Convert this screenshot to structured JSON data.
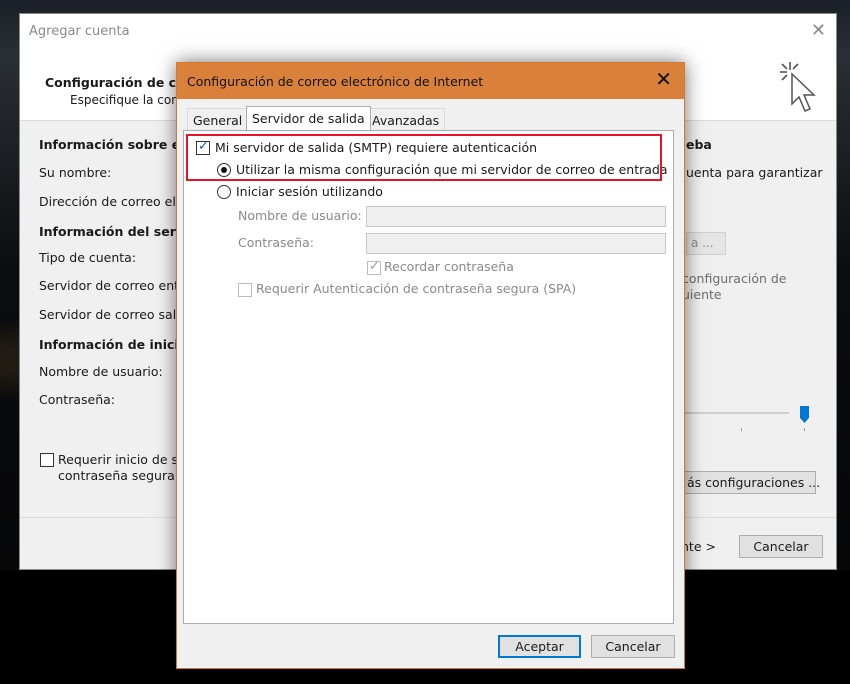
{
  "background_window": {
    "title": "Agregar cuenta",
    "close_glyph": "✕",
    "header_title": "Configuración de cue",
    "header_subtitle": "Especifique la confi",
    "left": {
      "section_user": "Información sobre el u",
      "your_name": "Su nombre:",
      "email": "Dirección de correo ele",
      "section_server": "Información del servido",
      "account_type": "Tipo de cuenta:",
      "incoming_server": "Servidor de correo entr",
      "outgoing_server": "Servidor de correo salie",
      "section_login": "Información de inicio d",
      "username": "Nombre de usuario:",
      "password": "Contraseña:",
      "require_login_line1": "Requerir inicio de se",
      "require_login_line2": "contraseña segura ("
    },
    "right": {
      "test_heading": "eba",
      "test_text": "uenta para garantizar",
      "test_button": "a ...",
      "config_text_line1": "configuración de",
      "config_text_line2": "uiente",
      "more_settings_button": "ás configuraciones ...",
      "next_button": "nte >",
      "cancel_button": "Cancelar"
    }
  },
  "dialog": {
    "title": "Configuración de correo electrónico de Internet",
    "close_glyph": "✕",
    "tabs": [
      {
        "label": "General",
        "active": false
      },
      {
        "label": "Servidor de salida",
        "active": true
      },
      {
        "label": "Avanzadas",
        "active": false
      }
    ],
    "smtp_auth": {
      "label": "Mi servidor de salida (SMTP) requiere autenticación",
      "checked": true
    },
    "use_same": {
      "label": "Utilizar la misma configuración que mi servidor de correo de entrada",
      "selected": true
    },
    "login_using": {
      "label": "Iniciar sesión utilizando",
      "selected": false
    },
    "username_label": "Nombre de usuario:",
    "username_value": "",
    "password_label": "Contraseña:",
    "password_value": "",
    "remember_password": {
      "label": "Recordar contraseña",
      "checked": true
    },
    "spa": {
      "label": "Requerir Autenticación de contraseña segura (SPA)",
      "checked": false
    },
    "ok_button": "Aceptar",
    "cancel_button": "Cancelar"
  },
  "colors": {
    "titlebar_accent": "#d9813b",
    "highlight_box": "#e4142a",
    "check_blue": "#0a56c2",
    "slider_blue": "#0078d7"
  }
}
